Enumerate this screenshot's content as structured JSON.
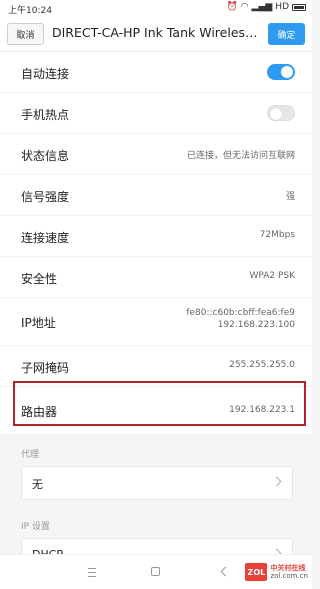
{
  "status_bar": {
    "time": "上午10:24",
    "carrier": "HD"
  },
  "header": {
    "cancel_label": "取消",
    "title": "DIRECT-CA-HP Ink Tank Wireless…",
    "ok_label": "确定"
  },
  "rows": {
    "auto_connect": {
      "label": "自动连接",
      "toggle_on": true
    },
    "hotspot": {
      "label": "手机热点",
      "toggle_on": false
    },
    "status": {
      "label": "状态信息",
      "value": "已连接，但无法访问互联网"
    },
    "signal": {
      "label": "信号强度",
      "value": "强"
    },
    "speed": {
      "label": "连接速度",
      "value": "72Mbps"
    },
    "security": {
      "label": "安全性",
      "value": "WPA2 PSK"
    },
    "ip": {
      "label": "IP地址",
      "value_line1": "fe80::c60b:cbff:fea6:fe9",
      "value_line2": "192.168.223.100"
    },
    "subnet": {
      "label": "子网掩码",
      "value": "255.255.255.0"
    },
    "router": {
      "label": "路由器",
      "value": "192.168.223.1"
    }
  },
  "proxy": {
    "section_label": "代理",
    "selected": "无"
  },
  "ip_settings": {
    "section_label": "IP 设置",
    "selected": "DHCP"
  },
  "watermark": {
    "logo_text": "ZOL",
    "line1": "中关村在线",
    "line2": "zol.com.cn"
  },
  "colors": {
    "accent": "#2f9bf0",
    "highlight": "#b2222a"
  }
}
